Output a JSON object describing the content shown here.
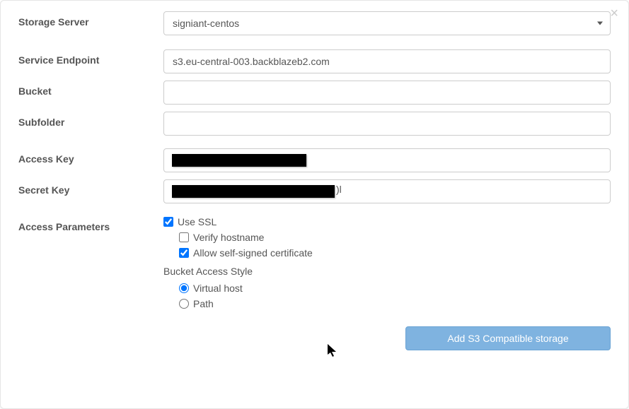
{
  "close_label": "×",
  "labels": {
    "storage_server": "Storage Server",
    "service_endpoint": "Service Endpoint",
    "bucket": "Bucket",
    "subfolder": "Subfolder",
    "access_key": "Access Key",
    "secret_key": "Secret Key",
    "access_parameters": "Access Parameters"
  },
  "fields": {
    "storage_server": {
      "value": "signiant-centos"
    },
    "service_endpoint": {
      "value": "s3.eu-central-003.backblazeb2.com"
    },
    "bucket": {
      "value": ""
    },
    "subfolder": {
      "value": ""
    },
    "access_key": {
      "value": ""
    },
    "secret_key": {
      "value": "",
      "trail": ")l"
    }
  },
  "params": {
    "use_ssl": {
      "label": "Use SSL",
      "checked": true
    },
    "verify_hostname": {
      "label": "Verify hostname",
      "checked": false
    },
    "allow_self_signed": {
      "label": "Allow self-signed certificate",
      "checked": true
    },
    "bucket_access_style": {
      "label": "Bucket Access Style",
      "selected": "virtual_host",
      "options": {
        "virtual_host": "Virtual host",
        "path": "Path"
      }
    }
  },
  "buttons": {
    "submit": "Add S3 Compatible storage"
  }
}
